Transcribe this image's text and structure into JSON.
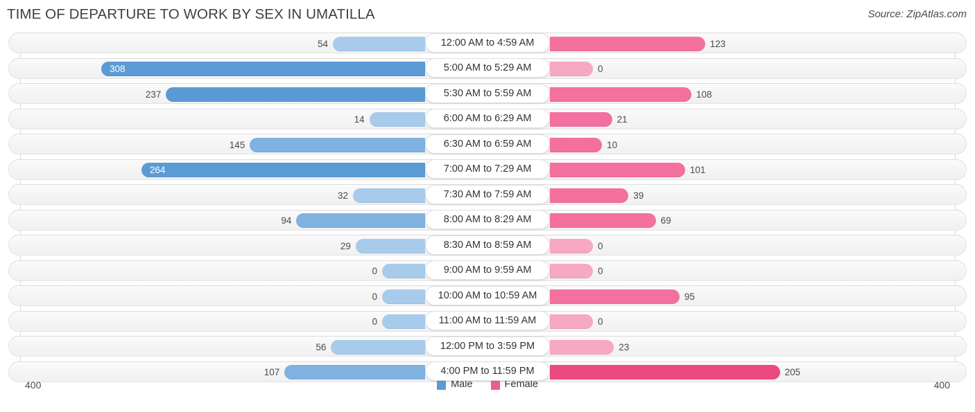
{
  "header": {
    "title": "TIME OF DEPARTURE TO WORK BY SEX IN UMATILLA",
    "source": "Source: ZipAtlas.com"
  },
  "axis": {
    "left_label": "400",
    "right_label": "400",
    "max": 400,
    "min": 0
  },
  "legend": [
    {
      "label": "Male",
      "color": "#5b9bd5"
    },
    {
      "label": "Female",
      "color": "#ef5d8f"
    }
  ],
  "colors": {
    "male_dark": "#5b9bd5",
    "male_mid": "#7fb2e0",
    "male_light": "#a8cbec",
    "female_dark": "#ec4a7f",
    "female_mid": "#f3709f",
    "female_light": "#f7a8c4",
    "track": "#f4f4f4",
    "axis": "#d8d8d8"
  },
  "chart_data": {
    "type": "bar",
    "subtype": "diverging-bidirectional",
    "title": "Time of Departure to Work by Sex in Umatilla",
    "xlabel": "",
    "ylabel": "",
    "xlim": [
      400,
      400
    ],
    "grid": false,
    "legend_position": "bottom-center",
    "categories": [
      "12:00 AM to 4:59 AM",
      "5:00 AM to 5:29 AM",
      "5:30 AM to 5:59 AM",
      "6:00 AM to 6:29 AM",
      "6:30 AM to 6:59 AM",
      "7:00 AM to 7:29 AM",
      "7:30 AM to 7:59 AM",
      "8:00 AM to 8:29 AM",
      "8:30 AM to 8:59 AM",
      "9:00 AM to 9:59 AM",
      "10:00 AM to 10:59 AM",
      "11:00 AM to 11:59 AM",
      "12:00 PM to 3:59 PM",
      "4:00 PM to 11:59 PM"
    ],
    "series": [
      {
        "name": "Male",
        "color": "#5b9bd5",
        "values": [
          54,
          308,
          237,
          14,
          145,
          264,
          32,
          94,
          29,
          0,
          0,
          0,
          56,
          107
        ]
      },
      {
        "name": "Female",
        "color": "#ef5d8f",
        "values": [
          123,
          0,
          108,
          21,
          10,
          101,
          39,
          69,
          0,
          0,
          95,
          0,
          23,
          205
        ]
      }
    ]
  },
  "rows": [
    {
      "label": "12:00 AM to 4:59 AM",
      "male": "54",
      "female": "123",
      "male_val": 54,
      "female_val": 123,
      "male_shade": "light",
      "female_shade": "mid",
      "male_inside": false,
      "female_inside": false
    },
    {
      "label": "5:00 AM to 5:29 AM",
      "male": "308",
      "female": "0",
      "male_val": 308,
      "female_val": 0,
      "male_shade": "dark",
      "female_shade": "light",
      "male_inside": true,
      "female_inside": false
    },
    {
      "label": "5:30 AM to 5:59 AM",
      "male": "237",
      "female": "108",
      "male_val": 237,
      "female_val": 108,
      "male_shade": "dark",
      "female_shade": "mid",
      "male_inside": false,
      "female_inside": false
    },
    {
      "label": "6:00 AM to 6:29 AM",
      "male": "14",
      "female": "21",
      "male_val": 14,
      "female_val": 21,
      "male_shade": "light",
      "female_shade": "mid",
      "male_inside": false,
      "female_inside": false
    },
    {
      "label": "6:30 AM to 6:59 AM",
      "male": "145",
      "female": "10",
      "male_val": 145,
      "female_val": 10,
      "male_shade": "mid",
      "female_shade": "mid",
      "male_inside": false,
      "female_inside": false
    },
    {
      "label": "7:00 AM to 7:29 AM",
      "male": "264",
      "female": "101",
      "male_val": 264,
      "female_val": 101,
      "male_shade": "dark",
      "female_shade": "mid",
      "male_inside": true,
      "female_inside": false
    },
    {
      "label": "7:30 AM to 7:59 AM",
      "male": "32",
      "female": "39",
      "male_val": 32,
      "female_val": 39,
      "male_shade": "light",
      "female_shade": "mid",
      "male_inside": false,
      "female_inside": false
    },
    {
      "label": "8:00 AM to 8:29 AM",
      "male": "94",
      "female": "69",
      "male_val": 94,
      "female_val": 69,
      "male_shade": "mid",
      "female_shade": "mid",
      "male_inside": false,
      "female_inside": false
    },
    {
      "label": "8:30 AM to 8:59 AM",
      "male": "29",
      "female": "0",
      "male_val": 29,
      "female_val": 0,
      "male_shade": "light",
      "female_shade": "light",
      "male_inside": false,
      "female_inside": false
    },
    {
      "label": "9:00 AM to 9:59 AM",
      "male": "0",
      "female": "0",
      "male_val": 0,
      "female_val": 0,
      "male_shade": "light",
      "female_shade": "light",
      "male_inside": false,
      "female_inside": false
    },
    {
      "label": "10:00 AM to 10:59 AM",
      "male": "0",
      "female": "95",
      "male_val": 0,
      "female_val": 95,
      "male_shade": "light",
      "female_shade": "mid",
      "male_inside": false,
      "female_inside": false
    },
    {
      "label": "11:00 AM to 11:59 AM",
      "male": "0",
      "female": "0",
      "male_val": 0,
      "female_val": 0,
      "male_shade": "light",
      "female_shade": "light",
      "male_inside": false,
      "female_inside": false
    },
    {
      "label": "12:00 PM to 3:59 PM",
      "male": "56",
      "female": "23",
      "male_val": 56,
      "female_val": 23,
      "male_shade": "light",
      "female_shade": "light",
      "male_inside": false,
      "female_inside": false
    },
    {
      "label": "4:00 PM to 11:59 PM",
      "male": "107",
      "female": "205",
      "male_val": 107,
      "female_val": 205,
      "male_shade": "mid",
      "female_shade": "dark",
      "male_inside": false,
      "female_inside": false
    }
  ]
}
